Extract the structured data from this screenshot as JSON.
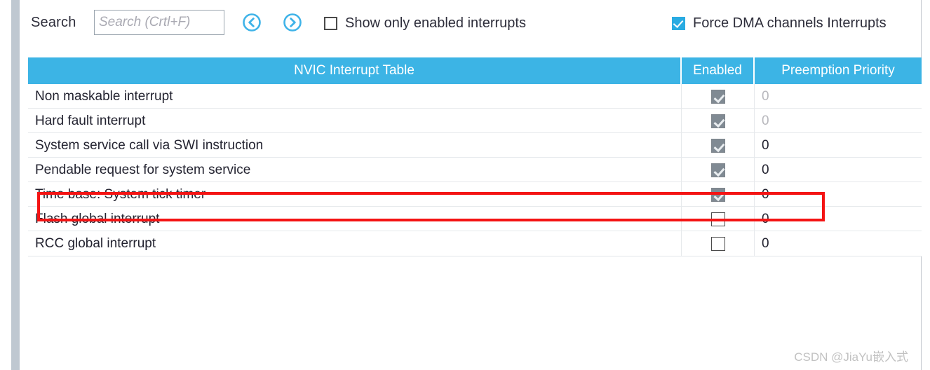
{
  "toolbar": {
    "search_label": "Search",
    "search_value": "",
    "search_placeholder": "Search (Crtl+F)",
    "prev_icon": "chevron-left-circle-icon",
    "next_icon": "chevron-right-circle-icon",
    "show_only_enabled": {
      "label": "Show only enabled interrupts",
      "checked": false
    },
    "force_dma": {
      "label": "Force DMA channels Interrupts",
      "checked": true
    }
  },
  "table": {
    "headers": {
      "name": "NVIC Interrupt Table",
      "enabled": "Enabled",
      "priority": "Preemption Priority"
    },
    "rows": [
      {
        "name": "Non maskable interrupt",
        "enabled": true,
        "enabled_locked": true,
        "priority": "0",
        "priority_dim": true,
        "highlighted": false
      },
      {
        "name": "Hard fault interrupt",
        "enabled": true,
        "enabled_locked": true,
        "priority": "0",
        "priority_dim": true,
        "highlighted": false
      },
      {
        "name": "System service call via SWI instruction",
        "enabled": true,
        "enabled_locked": true,
        "priority": "0",
        "priority_dim": false,
        "highlighted": false
      },
      {
        "name": "Pendable request for system service",
        "enabled": true,
        "enabled_locked": true,
        "priority": "0",
        "priority_dim": false,
        "highlighted": false
      },
      {
        "name": "Time base: System tick timer",
        "enabled": true,
        "enabled_locked": true,
        "priority": "0",
        "priority_dim": false,
        "highlighted": true
      },
      {
        "name": "Flash global interrupt",
        "enabled": false,
        "enabled_locked": false,
        "priority": "0",
        "priority_dim": false,
        "highlighted": false
      },
      {
        "name": "RCC global interrupt",
        "enabled": false,
        "enabled_locked": false,
        "priority": "0",
        "priority_dim": false,
        "highlighted": false
      }
    ]
  },
  "annotation": {
    "highlight_color": "#f41414",
    "highlight_row_index": 4
  },
  "watermark": {
    "text": "CSDN @JiaYu嵌入式"
  },
  "colors": {
    "header_blue": "#3cb4e5",
    "accent_blue": "#29abe2",
    "scrollbar": "#bfc8d1"
  }
}
